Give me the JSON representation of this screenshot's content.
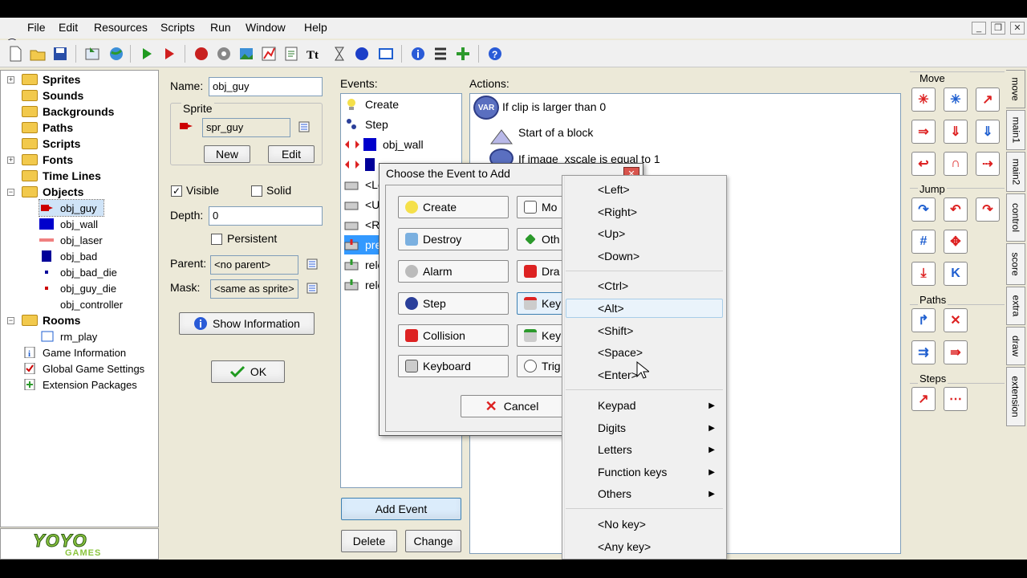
{
  "menu": [
    "File",
    "Edit",
    "Resources",
    "Scripts",
    "Run",
    "Window",
    "Help"
  ],
  "window_controls": {
    "minimize": "_",
    "restore": "❐",
    "close": "✕"
  },
  "tree": {
    "items": [
      {
        "label": "Sprites",
        "type": "folder",
        "expanded": false
      },
      {
        "label": "Sounds",
        "type": "folder"
      },
      {
        "label": "Backgrounds",
        "type": "folder"
      },
      {
        "label": "Paths",
        "type": "folder"
      },
      {
        "label": "Scripts",
        "type": "folder"
      },
      {
        "label": "Fonts",
        "type": "folder",
        "expanded": false
      },
      {
        "label": "Time Lines",
        "type": "folder"
      },
      {
        "label": "Objects",
        "type": "folder",
        "expanded": true
      }
    ],
    "objects": [
      "obj_guy",
      "obj_wall",
      "obj_laser",
      "obj_bad",
      "obj_bad_die",
      "obj_guy_die",
      "obj_controller"
    ],
    "rooms_label": "Rooms",
    "rooms": [
      "rm_play"
    ],
    "extras": [
      "Game Information",
      "Global Game Settings",
      "Extension Packages"
    ]
  },
  "logo": {
    "main": "YOYO",
    "sub": "GAMES"
  },
  "props": {
    "name_label": "Name:",
    "name_value": "obj_guy",
    "sprite_label": "Sprite",
    "sprite_value": "spr_guy",
    "new_label": "New",
    "edit_label": "Edit",
    "visible_label": "Visible",
    "visible_checked": "✓",
    "solid_label": "Solid",
    "depth_label": "Depth:",
    "depth_value": "0",
    "persistent_label": "Persistent",
    "parent_label": "Parent:",
    "parent_value": "<no parent>",
    "mask_label": "Mask:",
    "mask_value": "<same as sprite>",
    "show_info_label": "Show Information",
    "ok_label": "OK"
  },
  "events": {
    "header": "Events:",
    "items": [
      "Create",
      "Step",
      "obj_wall",
      "",
      "<Le",
      "<Up",
      "<Ri",
      "pre",
      "rele",
      "rele"
    ],
    "add_label": "Add Event",
    "delete_label": "Delete",
    "change_label": "Change"
  },
  "actions": {
    "header": "Actions:",
    "items": [
      "If clip is larger than 0",
      "Start of a block",
      "If image_xscale is equal to 1"
    ],
    "var_icon": "VAR"
  },
  "right_panel": {
    "sections": [
      "Move",
      "Jump",
      "Paths",
      "Steps"
    ],
    "tabs": [
      "move",
      "main1",
      "main2",
      "control",
      "score",
      "extra",
      "draw",
      "extension"
    ]
  },
  "dialog": {
    "title": "Choose the Event to Add",
    "buttons_left": [
      "Create",
      "Destroy",
      "Alarm",
      "Step",
      "Collision",
      "Keyboard"
    ],
    "buttons_right": [
      "Mo",
      "Oth",
      "Dra",
      "Key",
      "Key",
      "Trig"
    ],
    "cancel_label": "Cancel"
  },
  "context_menu": {
    "group1": [
      "<Left>",
      "<Right>",
      "<Up>",
      "<Down>"
    ],
    "group2": [
      "<Ctrl>",
      "<Alt>",
      "<Shift>",
      "<Space>",
      "<Enter>"
    ],
    "group3": [
      "Keypad",
      "Digits",
      "Letters",
      "Function keys",
      "Others"
    ],
    "group4": [
      "<No key>",
      "<Any key>"
    ],
    "highlighted": "<Alt>"
  },
  "colors": {
    "accent": "#3399ff",
    "selection": "#cfe3f7",
    "object_red": "#cc0000",
    "object_blue": "#0000cc"
  }
}
